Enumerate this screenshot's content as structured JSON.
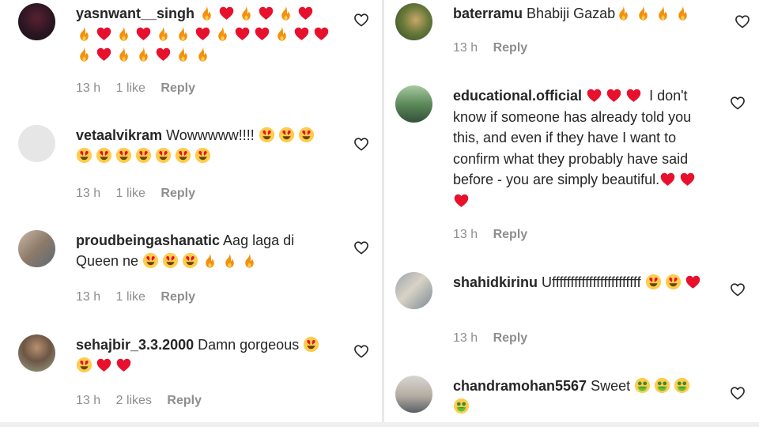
{
  "left_comments": [
    {
      "username": "yasnwant__singh",
      "text": "",
      "emojis": [
        "fire",
        "red-heart",
        "fire",
        "red-heart",
        "fire",
        "red-heart",
        "fire",
        "red-heart",
        "fire",
        "red-heart",
        "fire",
        "fire",
        "red-heart",
        "fire",
        "red-heart",
        "red-heart",
        "fire",
        "red-heart",
        "red-heart",
        "fire",
        "red-heart",
        "fire",
        "fire",
        "red-heart",
        "fire",
        "fire"
      ],
      "time": "13 h",
      "likes": "1 like",
      "reply": "Reply"
    },
    {
      "username": "vetaalvikram",
      "text": "Wowwwww!!!!",
      "emojis": [
        "heart-eyes",
        "heart-eyes",
        "heart-eyes",
        "heart-eyes",
        "heart-eyes",
        "heart-eyes",
        "heart-eyes",
        "heart-eyes",
        "heart-eyes",
        "heart-eyes"
      ],
      "time": "13 h",
      "likes": "1 like",
      "reply": "Reply"
    },
    {
      "username": "proudbeingashanatic",
      "text": "Aag laga di Queen ne",
      "emojis": [
        "heart-eyes",
        "heart-eyes",
        "heart-eyes",
        "fire",
        "fire",
        "fire"
      ],
      "time": "13 h",
      "likes": "1 like",
      "reply": "Reply"
    },
    {
      "username": "sehajbir_3.3.2000",
      "text": "Damn gorgeous",
      "emojis": [
        "heart-eyes",
        "heart-eyes",
        "red-heart",
        "red-heart"
      ],
      "time": "13 h",
      "likes": "2 likes",
      "reply": "Reply"
    }
  ],
  "right_comments": [
    {
      "username": "baterramu",
      "text": "Bhabiji Gazab",
      "emojis": [
        "fire",
        "fire",
        "fire",
        "fire"
      ],
      "time": "13 h",
      "likes": "",
      "reply": "Reply"
    },
    {
      "username": "educational.official",
      "text": "",
      "emojis": [
        "red-heart",
        "red-heart",
        "red-heart"
      ],
      "text_after": "I don't know if someone has already told you this, and even if they have I want to confirm what they probably have said before - you are simply beautiful.",
      "emojis_after": [
        "red-heart",
        "red-heart",
        "red-heart"
      ],
      "time": "13 h",
      "likes": "",
      "reply": "Reply"
    },
    {
      "username": "shahidkirinu",
      "text": "Uffffffffffffffffffffffff",
      "emojis": [
        "heart-eyes",
        "heart-eyes",
        "red-heart"
      ],
      "time": "13 h",
      "likes": "",
      "reply": "Reply"
    },
    {
      "username": "chandramohan5567",
      "text": "Sweet",
      "emojis": [
        "money-mouth",
        "money-mouth",
        "money-mouth",
        "money-mouth"
      ],
      "time": "",
      "likes": "",
      "reply": ""
    }
  ],
  "icons": {
    "like": "heart-outline-icon",
    "fire": "fire-icon",
    "red-heart": "red-heart-icon",
    "heart-eyes": "heart-eyes-icon",
    "money-mouth": "money-mouth-icon"
  },
  "colors": {
    "username": "#262626",
    "meta": "#8e8e8e",
    "heart_red": "#e8112d",
    "fire_orange": "#f4900c",
    "emoji_yellow": "#ffcc4d"
  }
}
